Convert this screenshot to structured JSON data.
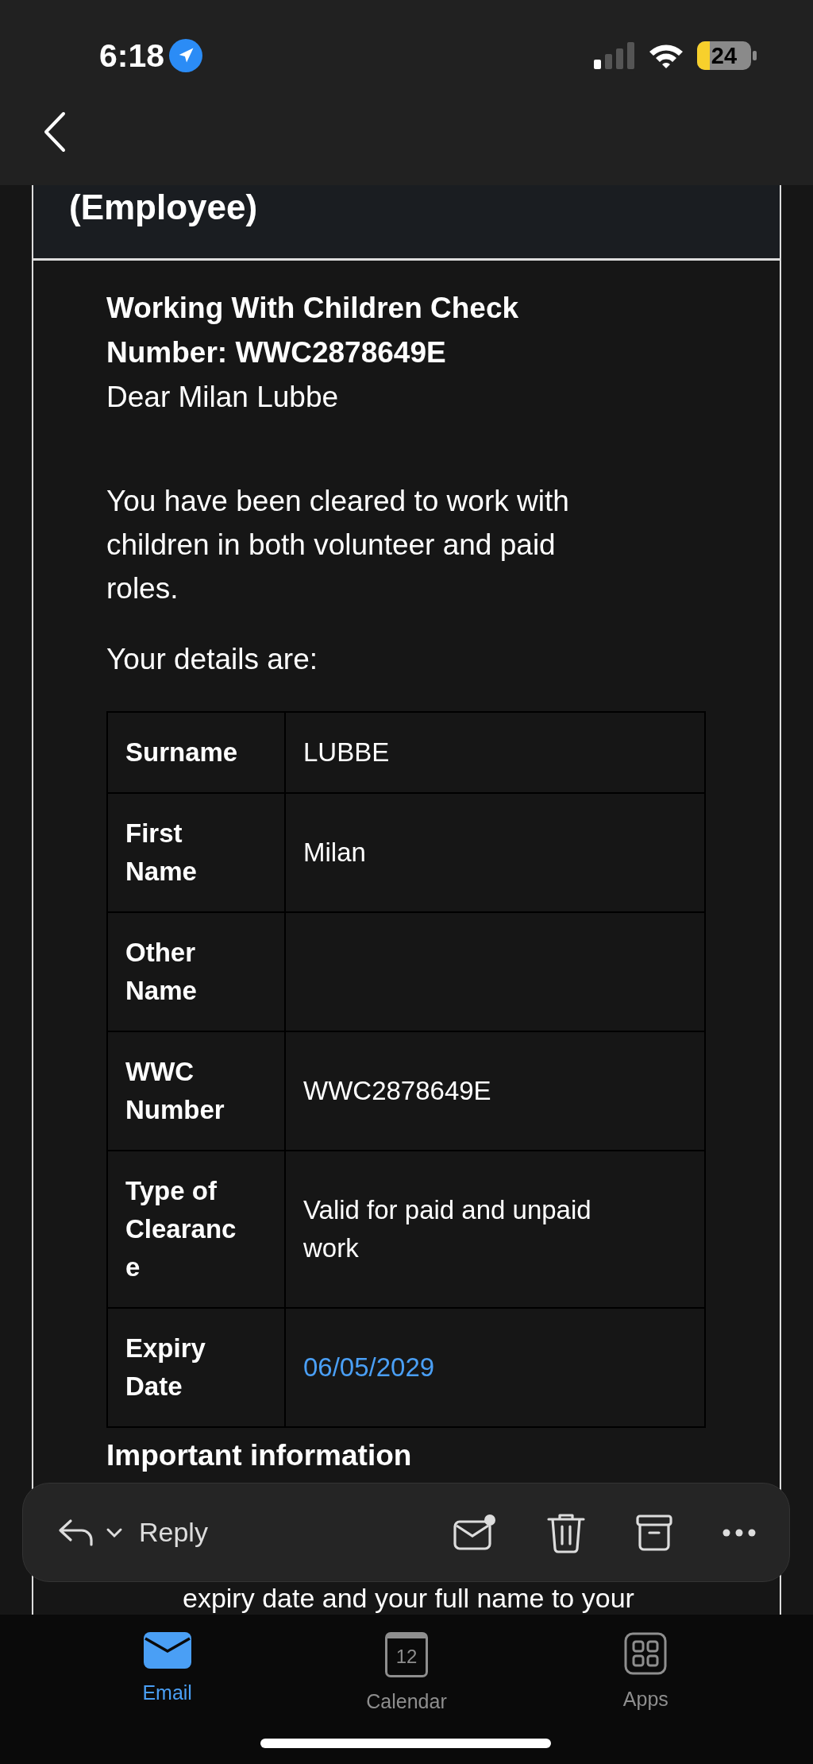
{
  "status_bar": {
    "time": "6:18",
    "battery": "24"
  },
  "email": {
    "header_text": "(Employee)",
    "title": "Working With Children Check Number: WWC2878649E",
    "greeting": "Dear Milan Lubbe",
    "message": "You have been cleared to work with children in both volunteer and paid roles.",
    "details_intro": "Your details are:",
    "details": [
      {
        "label": "Surname",
        "value": "LUBBE",
        "link": false
      },
      {
        "label": "First Name",
        "value": "Milan",
        "link": false
      },
      {
        "label": "Other Name",
        "link": false
      },
      {
        "label": "WWC Number",
        "value": "WWC2878649E",
        "link": false
      },
      {
        "label": "Type of Clearance",
        "value": "Valid for paid and unpaid work",
        "link": false
      },
      {
        "label": "Expiry Date",
        "value": "06/05/2029",
        "link": true
      }
    ],
    "section_heading": "Important information",
    "partial_text": "expiry date and your full name to your"
  },
  "toolbar": {
    "reply_label": "Reply"
  },
  "tabs": [
    {
      "label": "Email",
      "kind": "email",
      "selected": true
    },
    {
      "label": "Calendar",
      "kind": "calendar",
      "selected": false,
      "icon_text": "12"
    },
    {
      "label": "Apps",
      "kind": "apps",
      "selected": false
    }
  ]
}
